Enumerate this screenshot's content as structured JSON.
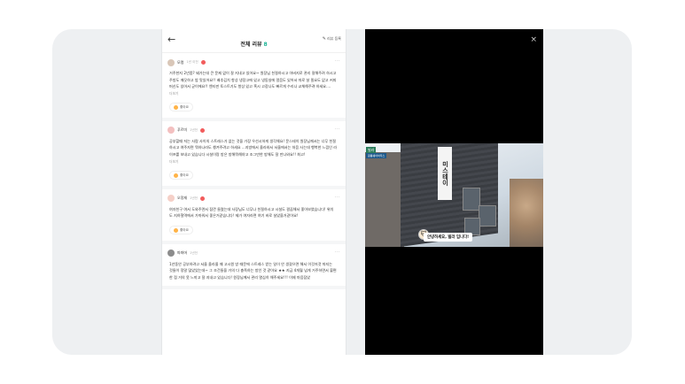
{
  "header": {
    "title": "전체 리뷰",
    "count": "8",
    "write_label": "리뷰 등록"
  },
  "reviews": [
    {
      "user": "모랭",
      "meta": "1년 이전",
      "text": "거주한지 2년쯤? 돼가는데 큰 문제 없이 잘 지내고 있어요~ 원장님 친절하시고 아버지로 관리 잘해주려 하시고 주방도 깨끗하고 밥 맛있어요!! 배추김치 항상 냉장고에 있고 냉동실에 얼음도 있어서 따로 살 필요도 없고 커피머신도 있어서 굳이에요!! 엔티핀 토스트기도 항상 있고 혹시 고장나도 빠르게 수리나 교체해주려 하세요....",
      "more": "더보기",
      "like": "좋아요"
    },
    {
      "user": "푸르미",
      "meta": "1년전",
      "text": "공부할때 저는 사람 사이의 스트레스가 없는 것을 가장 우선시하게 생각해요! 문스테이 원장님께서는 너무 친절하시고 여주자면 뭐하나라도 챙겨주려고 하세요 ...지방에서 올라와서 서울에서는 처음 사는데 행복한 느낌인 라이프를 보내고 있습니다        시설이랑 방은 방해뭐해야고 조그만한 방해도 잘 만나와요!! 최고!",
      "more": "더보기",
      "like": "좋아요"
    },
    {
      "user": "오정재",
      "meta": "1년전",
      "text": "여자친구 여서 도와주면서 잠깐 들렸는데 사장님도 너무나 친절하시고 시설도 깔끔해서 좋아보였습니다! 위치도 지하철역에서 가까워서 좋은거같습니다! 제가 여자라면 여기 바로 살았을거같아요!",
      "like": "좋아요"
    },
    {
      "user": "파파머",
      "meta": "1년전",
      "text": "1년동안 공부하려고 서울 올라올 때 고시원 방 때문에 스트레스 받는 일이 안 생겼으면 해서 이것저것 따지는 것들이 정말 많았었는데~ 그 조건들을 거의 다 충족하는 방인 것 같아요 ★★ 지금 4개월 넘게 거주하면서 불편한 점 거의 못 느끼고 잘 지내고 있습니다! 원장님께서 관리 열심히 해주세요!!! 이제 마음잡았"
    }
  ],
  "video": {
    "sign_text": "미스테이",
    "store_tag": "빌라",
    "store_sub": "원룸쉐어하우스",
    "caption": "안녕하세요, 빌라 입니다!",
    "close": "×"
  }
}
